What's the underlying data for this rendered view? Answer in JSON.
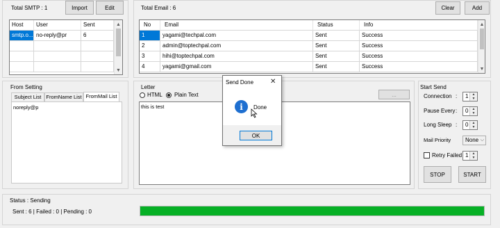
{
  "smtp": {
    "title": "Total SMTP : 1",
    "import_label": "Import",
    "edit_label": "Edit",
    "columns": [
      "Host",
      "User",
      "Sent"
    ],
    "rows": [
      [
        "smtp.o...",
        "no-reply@pr",
        "6"
      ]
    ]
  },
  "email": {
    "title": "Total Email : 6",
    "clear_label": "Clear",
    "add_label": "Add",
    "columns": [
      "No",
      "Email",
      "Status",
      "Info"
    ],
    "rows": [
      [
        "1",
        "yagami@techpal.com",
        "Sent",
        "Success"
      ],
      [
        "2",
        "admin@toptechpal.com",
        "Sent",
        "Success"
      ],
      [
        "3",
        "hihi@toptechpal.com",
        "Sent",
        "Success"
      ],
      [
        "4",
        "yagami@gmail.com",
        "Sent",
        "Success"
      ]
    ]
  },
  "from_setting": {
    "title": "From Setting",
    "tabs": [
      "Subject List",
      "FromName List",
      "FromMail List"
    ],
    "content": "noreply@p"
  },
  "letter": {
    "title": "Letter",
    "html_label": "HTML",
    "plain_label": "Plain Text",
    "browse_label": "...",
    "content": "this is test"
  },
  "start_send": {
    "title": "Start Send",
    "connection_label": "Connection",
    "connection_value": "1",
    "pause_label": "Pause Every",
    "pause_value": "0",
    "sleep_label": "Long Sleep",
    "sleep_value": "0",
    "priority_label": "Mail Priority",
    "priority_value": "None",
    "retry_label": "Retry Failed",
    "retry_value": "1",
    "colon": ":",
    "stop_label": "STOP",
    "start_label": "START"
  },
  "status": {
    "title": "Status : Sending",
    "counts": "Sent : 6 | Failed : 0 | Pending : 0",
    "progress": 1.0,
    "progress_color": "#06b025"
  },
  "dialog": {
    "title": "Send Done",
    "message": "Done",
    "ok_label": "OK",
    "close_glyph": "✕",
    "icon": "info-icon",
    "icon_glyph": "i",
    "icon_color": "#1e6fd0"
  }
}
